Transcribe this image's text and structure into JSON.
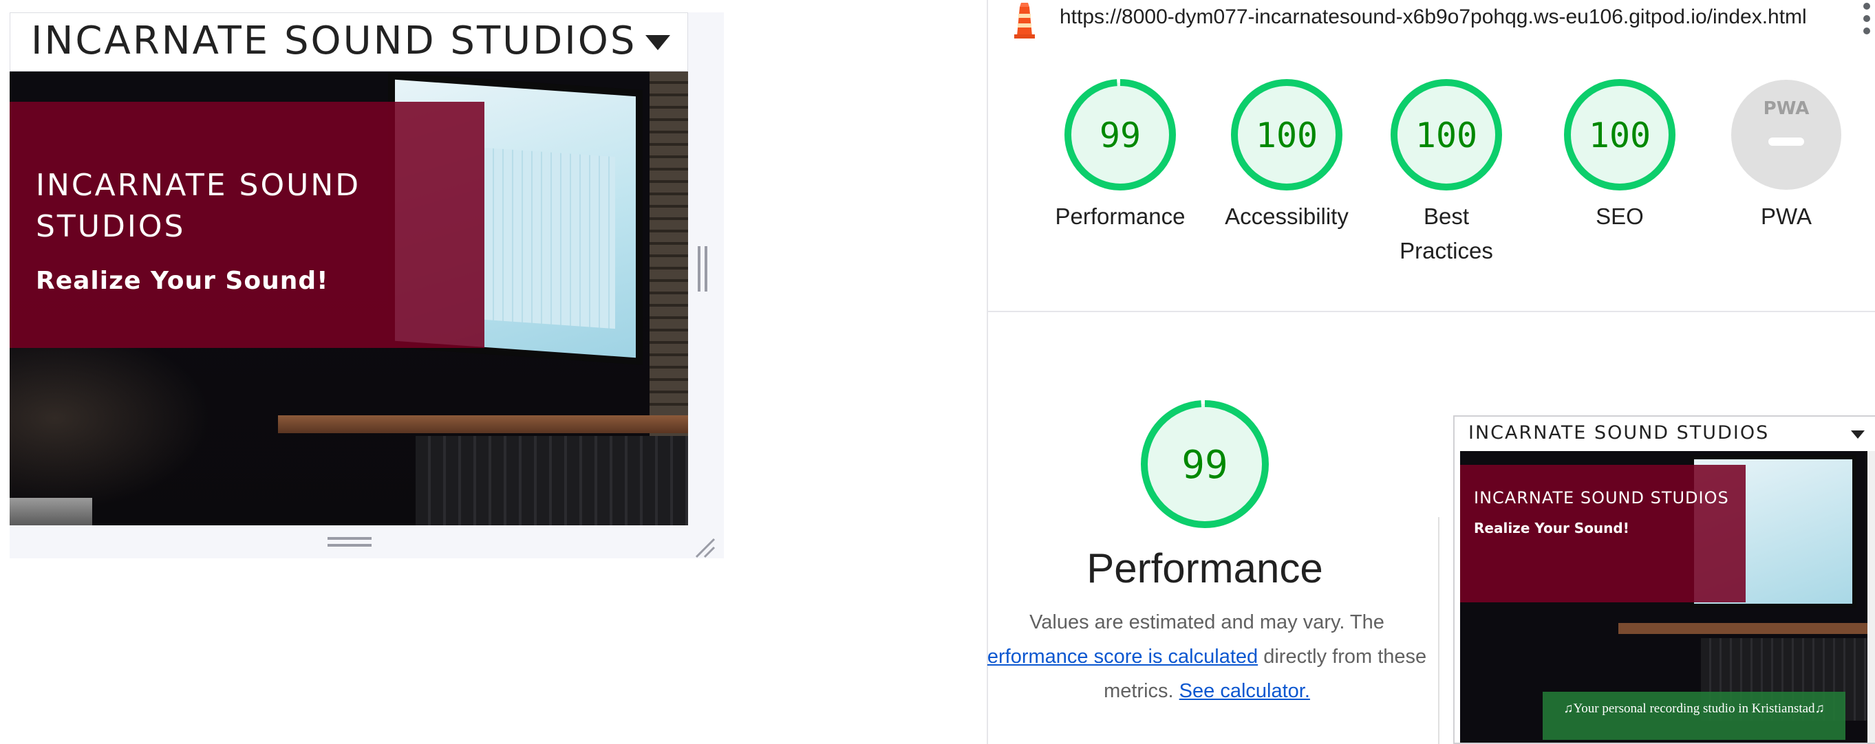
{
  "preview": {
    "brand": "INCARNATE SOUND STUDIOS",
    "hero_title": "INCARNATE SOUND STUDIOS",
    "hero_tagline": "Realize Your Sound!"
  },
  "lighthouse": {
    "url": "https://8000-dym077-incarnatesound-x6b9o7pohqg.ws-eu106.gitpod.io/index.html",
    "scores": [
      {
        "label": "Performance",
        "score": "99",
        "value": 99
      },
      {
        "label": "Accessibility",
        "score": "100",
        "value": 100
      },
      {
        "label": "Best Practices",
        "score": "100",
        "value": 100
      },
      {
        "label": "SEO",
        "score": "100",
        "value": 100
      },
      {
        "label": "PWA",
        "score": "",
        "value": null,
        "badge": "PWA"
      }
    ],
    "detail": {
      "score": "99",
      "title": "Performance",
      "desc_prefix": "Values are estimated and may vary. The",
      "desc_link": "erformance score is calculated",
      "desc_middle": "directly from these metrics.",
      "calc_link": "See calculator."
    },
    "thumbnail": {
      "brand": "INCARNATE SOUND STUDIOS",
      "hero_title": "INCARNATE SOUND STUDIOS",
      "hero_tagline": "Realize Your Sound!",
      "banner": "♫Your personal recording studio in Kristianstad♫"
    }
  },
  "colors": {
    "brand_burgundy": "#760023",
    "score_pass": "#0cce6b",
    "score_text": "#008800",
    "link": "#0b57d0"
  }
}
